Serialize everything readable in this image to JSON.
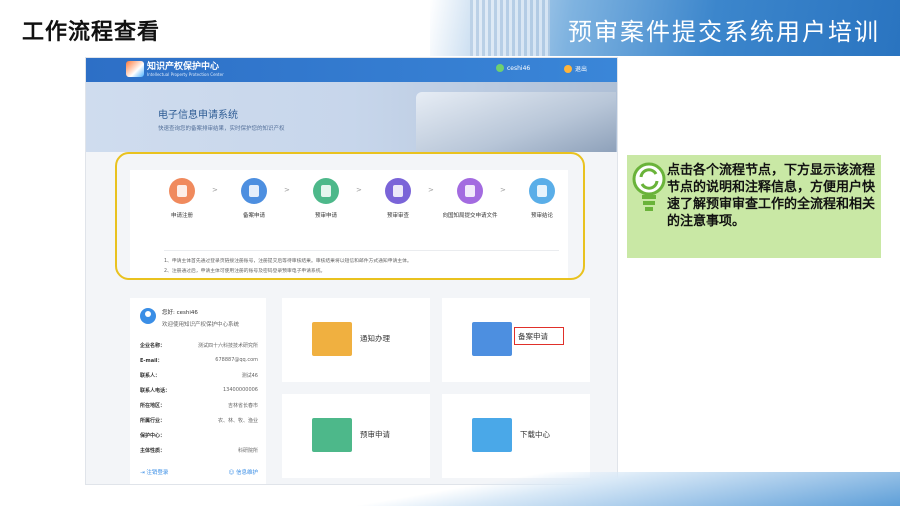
{
  "slide": {
    "title_left": "工作流程查看",
    "title_right": "预审案件提交系统用户培训"
  },
  "app": {
    "logo_name": "知识产权保护中心",
    "logo_en": "Intellectual Property Protection Center",
    "user": "ceshi46",
    "logout": "退出",
    "banner_title": "电子信息申请系统",
    "banner_subtitle": "快速查询您的备案排审结果，实时保护您的知识产权",
    "steps": [
      {
        "label": "申请注册",
        "color": "#f08a5d"
      },
      {
        "label": "备案申请",
        "color": "#4d8fe0"
      },
      {
        "label": "预审申请",
        "color": "#4db88a"
      },
      {
        "label": "预审审查",
        "color": "#7a64d8"
      },
      {
        "label": "向国知局提交申请文件",
        "color": "#a36be0"
      },
      {
        "label": "预审结论",
        "color": "#5aaee8"
      }
    ],
    "notes": [
      "1、申请主体首先通过登录页链接注册账号，注册提交后等待审核结果。审核结果将以短信和邮件方式通知申请主体。",
      "2、注册通过后，申请主体可使用注册的账号及密码登录预审电子申请系统。"
    ],
    "profile": {
      "greeting": "您好: ceshi46",
      "welcome": "欢迎使用知识产权保护中心系统",
      "rows": [
        {
          "k": "企业名称：",
          "v": "测试四十六科技技术研究所"
        },
        {
          "k": "E-mail：",
          "v": "678887@qq.com"
        },
        {
          "k": "联系人：",
          "v": "测试46"
        },
        {
          "k": "联系人电话：",
          "v": "13400000006"
        },
        {
          "k": "所在地区：",
          "v": "吉林省长春市"
        },
        {
          "k": "所属行业：",
          "v": "农、林、牧、渔业"
        },
        {
          "k": "保护中心：",
          "v": ""
        },
        {
          "k": "主体性质：",
          "v": "科研院所"
        }
      ],
      "action_cancel": "注销登录",
      "action_info": "信息维护"
    },
    "tiles": {
      "notice": "通知办理",
      "record": "备案申请",
      "pretrial": "预审申请",
      "download": "下载中心"
    }
  },
  "callout": {
    "text": "点击各个流程节点，下方显示该流程节点的说明和注释信息，方便用户快速了解预审审查工作的全流程和相关的注意事项。"
  }
}
